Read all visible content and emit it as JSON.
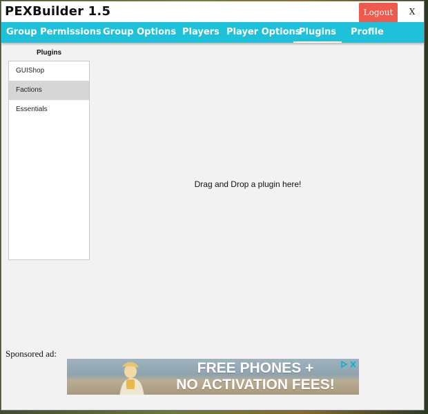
{
  "app": {
    "title": "PEXBuilder 1.5",
    "logout_label": "Logout",
    "close_label": "X"
  },
  "nav": {
    "tabs": [
      {
        "label": "Group Permissions",
        "active": false
      },
      {
        "label": "Group Options",
        "active": false
      },
      {
        "label": "Players",
        "active": false
      },
      {
        "label": "Player Options",
        "active": false
      },
      {
        "label": "Plugins",
        "active": true
      },
      {
        "label": "Profile",
        "active": false
      }
    ]
  },
  "sidebar": {
    "heading": "Plugins",
    "items": [
      {
        "label": "GUIShop",
        "selected": false
      },
      {
        "label": "Factions",
        "selected": true
      },
      {
        "label": "Essentials",
        "selected": false
      }
    ]
  },
  "main": {
    "drop_text": "Drag and Drop a plugin here!"
  },
  "ad": {
    "label": "Sponsored ad:",
    "line1": "FREE PHONES +",
    "line2": "NO ACTIVATION FEES!",
    "icons": [
      "adchoices-icon",
      "ad-close-icon"
    ]
  },
  "colors": {
    "nav_bg": "#1ec0da",
    "logout_bg": "#ef5a4f",
    "window_bg": "#f2f2f2",
    "selected_item_bg": "#d6d6d6"
  }
}
